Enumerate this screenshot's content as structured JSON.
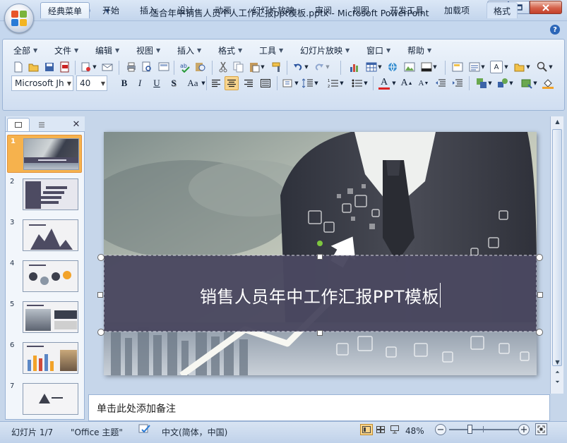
{
  "window": {
    "title": "适合年中销售人员个人工作汇报ppt模板.pptx - Microsoft PowerPoint",
    "minimize_icon": "minimize-icon",
    "maximize_icon": "maximize-icon",
    "close_icon": "close-icon"
  },
  "quick_access": [
    "save-icon",
    "undo-icon",
    "redo-icon",
    "customize-dropdown-icon"
  ],
  "tabs": [
    {
      "label": "经典菜单",
      "active": true
    },
    {
      "label": "开始"
    },
    {
      "label": "插入"
    },
    {
      "label": "设计"
    },
    {
      "label": "动画"
    },
    {
      "label": "幻灯片放映"
    },
    {
      "label": "审阅"
    },
    {
      "label": "视图"
    },
    {
      "label": "开发工具"
    },
    {
      "label": "加载项"
    },
    {
      "label": "格式"
    }
  ],
  "menus": [
    "全部",
    "文件",
    "编辑",
    "视图",
    "插入",
    "格式",
    "工具",
    "幻灯片放映",
    "窗口",
    "帮助"
  ],
  "font": {
    "name": "Microsoft Jh",
    "size": "40"
  },
  "format_buttons": {
    "bold": "B",
    "italic": "I",
    "underline": "U",
    "shadow": "S",
    "change_case": "Aa",
    "font_color": "A",
    "grow": "A",
    "shrink": "A"
  },
  "pane_tabs": [
    "slides-tab",
    "outline-tab"
  ],
  "slides": [
    {
      "num": "1",
      "selected": true
    },
    {
      "num": "2"
    },
    {
      "num": "3"
    },
    {
      "num": "4"
    },
    {
      "num": "5"
    },
    {
      "num": "6"
    },
    {
      "num": "7"
    }
  ],
  "slide": {
    "title": "销售人员年中工作汇报PPT模板"
  },
  "notes": {
    "placeholder": "单击此处添加备注"
  },
  "status": {
    "slide_info": "幻灯片 1/7",
    "theme": "\"Office 主题\"",
    "language": "中文(简体，中国)",
    "zoom": "48%",
    "zoom_fraction": 0.48
  },
  "colors": {
    "accent": "#f6b24d",
    "banner": "#4a4860",
    "titlebar": "#c3d5ec"
  }
}
